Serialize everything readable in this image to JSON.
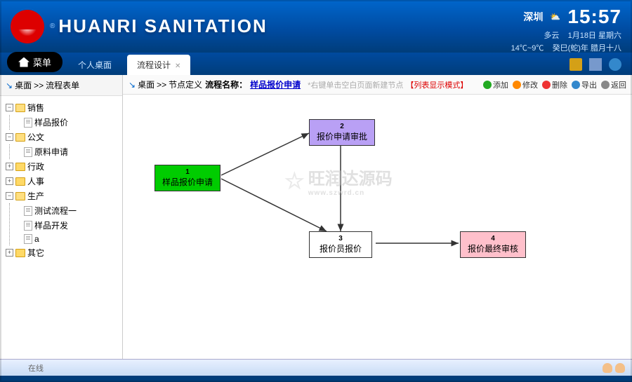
{
  "header": {
    "brand": "HUANRI SANITATION",
    "reg": "®",
    "weather": {
      "city": "深圳",
      "time": "15:57",
      "cond": "多云",
      "date": "1月18日 星期六",
      "temp": "14℃~9℃",
      "lunar": "癸巳(蛇)年 腊月十八"
    }
  },
  "tabbar": {
    "menu": "菜单",
    "tabs": [
      {
        "label": "个人桌面",
        "active": false
      },
      {
        "label": "流程设计",
        "active": true
      }
    ]
  },
  "sidebar": {
    "crumb1": "桌面",
    "crumb2": "流程表单",
    "tree": [
      {
        "label": "销售",
        "type": "folder",
        "open": true
      },
      {
        "label": "样品报价",
        "type": "doc",
        "child": true
      },
      {
        "label": "公文",
        "type": "folder",
        "open": true
      },
      {
        "label": "原料申请",
        "type": "doc",
        "child": true
      },
      {
        "label": "行政",
        "type": "folder",
        "open": false
      },
      {
        "label": "人事",
        "type": "folder",
        "open": false
      },
      {
        "label": "生产",
        "type": "folder",
        "open": true
      },
      {
        "label": "测试流程一",
        "type": "doc",
        "child": true
      },
      {
        "label": "样品开发",
        "type": "doc",
        "child": true
      },
      {
        "label": "a",
        "type": "doc",
        "child": true
      },
      {
        "label": "其它",
        "type": "folder",
        "open": false
      }
    ]
  },
  "main": {
    "crumb1": "桌面",
    "crumb2": "节点定义",
    "proc_label": "流程名称：",
    "proc_value": "样品报价申请",
    "hint": "*右键单击空白页面新建节点",
    "mode": "【列表显示模式】",
    "toolbar": {
      "add": "添加",
      "edit": "修改",
      "del": "删除",
      "exp": "导出",
      "back": "返回"
    },
    "nodes": {
      "n1": {
        "num": "1",
        "label": "样品报价申请"
      },
      "n2": {
        "num": "2",
        "label": "报价申请审批"
      },
      "n3": {
        "num": "3",
        "label": "报价员报价"
      },
      "n4": {
        "num": "4",
        "label": "报价最终审核"
      }
    },
    "watermark": {
      "text": "旺润达源码",
      "sub": "www.szwrd.cn"
    }
  },
  "status": {
    "text": "在线"
  }
}
